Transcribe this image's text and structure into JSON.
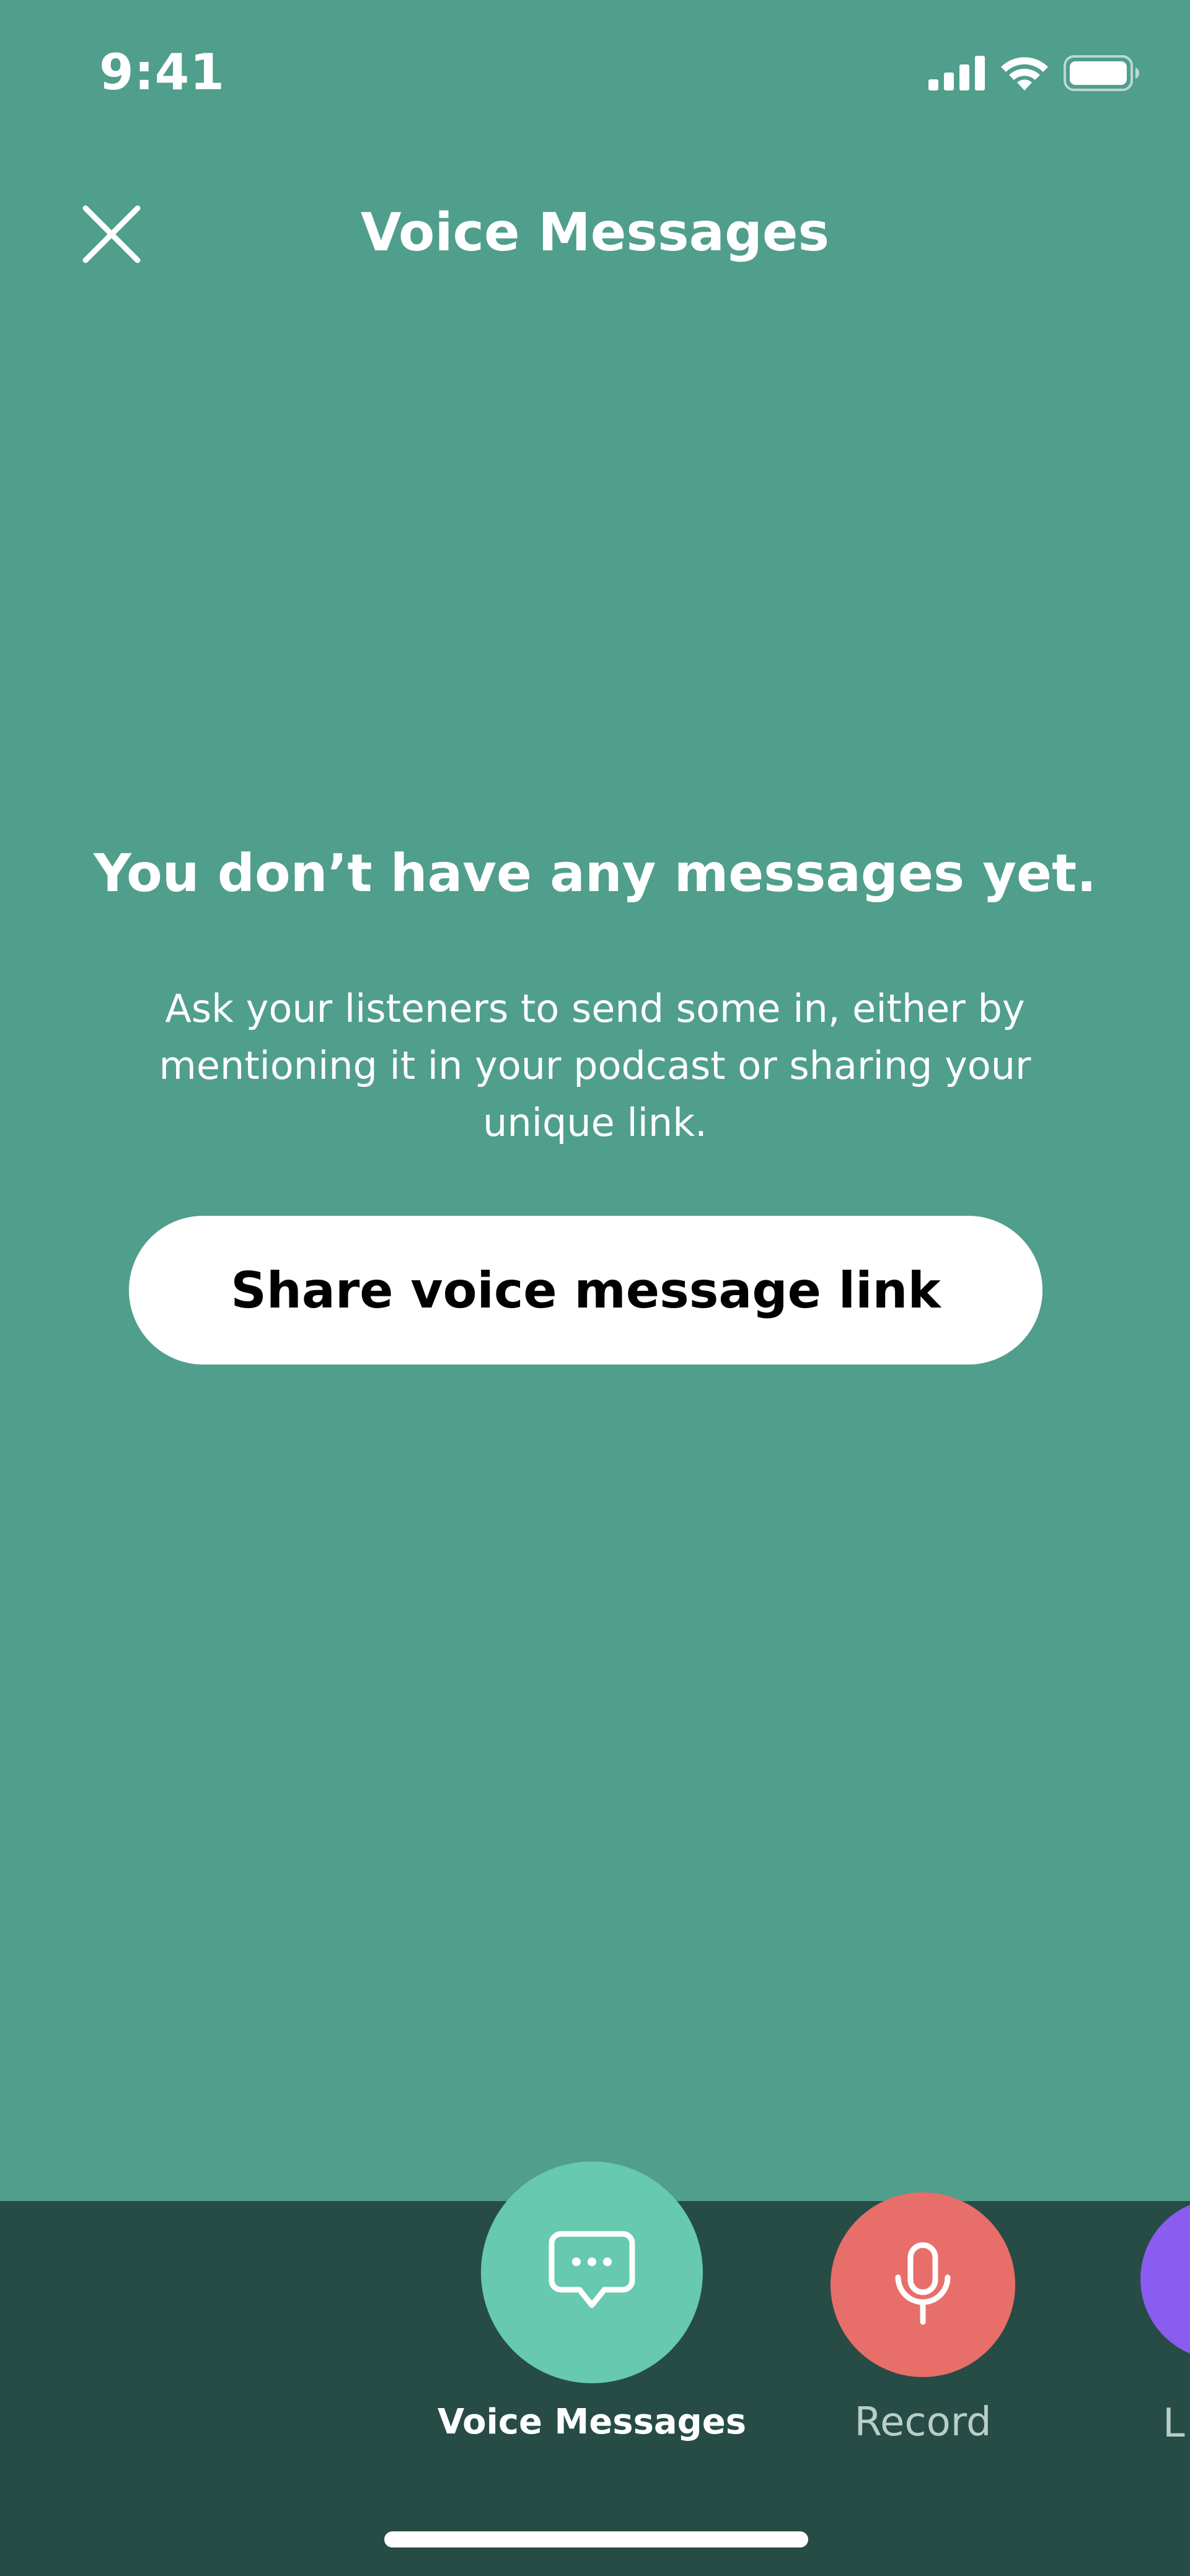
{
  "status_bar": {
    "time": "9:41",
    "signal_icon": "cellular-signal-icon",
    "wifi_icon": "wifi-icon",
    "battery_icon": "battery-icon"
  },
  "header": {
    "title": "Voice Messages",
    "close_icon": "close-icon"
  },
  "empty_state": {
    "title": "You don’t have any messages yet.",
    "description": "Ask your listeners to send some in, either by mentioning it in your podcast or sharing your unique link.",
    "share_button_label": "Share voice message link"
  },
  "bottom_nav": {
    "items": [
      {
        "label": "Voice Messages",
        "icon": "chat-bubble-icon",
        "color": "#66c9b0",
        "selected": true
      },
      {
        "label": "Record",
        "icon": "microphone-icon",
        "color": "#e86e6a",
        "selected": false
      },
      {
        "label": "L",
        "icon": "",
        "color": "#8a5cf0",
        "selected": false
      }
    ]
  },
  "colors": {
    "background": "#509e8c",
    "bottom_bar": "#264c45",
    "button_bg": "#ffffff"
  }
}
